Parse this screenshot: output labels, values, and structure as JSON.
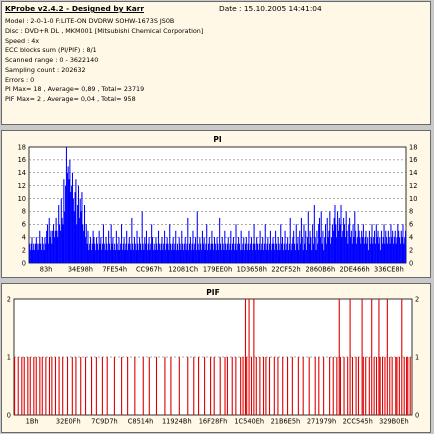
{
  "header": {
    "title": "KProbe v2.4.2 - Designed by Karr",
    "date": "Date : 15.10.2005 14:41:04",
    "lines": [
      "Model : 2-0-1-0 F:LITE-ON DVDRW SOHW-1673S JS0B",
      "Disc : DVD+R DL , MKM001 [Mitsubishi Chemical Corporation]",
      "Speed : 4x",
      "ECC blocks sum (PI/PIF) : 8/1",
      "Scanned range : 0 - 3622140",
      "Sampling count : 202632",
      "Errors : 0",
      "PI Max= 18 , Average= 0,89 , Total= 23719",
      "PIF Max= 2 , Average= 0,04 , Total= 958"
    ]
  },
  "chart_data": [
    {
      "type": "bar",
      "title": "PI",
      "color": "#0000ff",
      "ylim": [
        0,
        18
      ],
      "yticks": [
        "0",
        "2",
        "4",
        "6",
        "8",
        "10",
        "12",
        "14",
        "16",
        "18"
      ],
      "xticks": [
        "83h",
        "34E98h",
        "7FE54h",
        "CC967h",
        "12081Ch",
        "179EE0h",
        "1D3658h",
        "22CF52h",
        "2860B6h",
        "2DE466h",
        "336CE8h"
      ],
      "summary": {
        "max": 18,
        "average": 0.89,
        "total": 23719
      },
      "values": [
        3,
        2,
        3,
        4,
        2,
        3,
        2,
        3,
        4,
        3,
        2,
        3,
        5,
        3,
        2,
        4,
        3,
        2,
        4,
        3,
        5,
        6,
        3,
        7,
        4,
        5,
        3,
        5,
        6,
        4,
        5,
        7,
        5,
        4,
        9,
        6,
        5,
        10,
        7,
        6,
        13,
        8,
        12,
        18,
        14,
        15,
        13,
        16,
        11,
        12,
        14,
        10,
        8,
        11,
        13,
        6,
        9,
        12,
        7,
        10,
        8,
        11,
        6,
        5,
        9,
        4,
        6,
        3,
        5,
        2,
        3,
        4,
        2,
        3,
        5,
        4,
        3,
        2,
        4,
        3,
        2,
        5,
        3,
        4,
        2,
        3,
        6,
        3,
        2,
        4,
        3,
        2,
        5,
        3,
        2,
        6,
        3,
        4,
        2,
        3,
        2,
        5,
        3,
        2,
        4,
        2,
        3,
        6,
        2,
        3,
        4,
        2,
        3,
        5,
        2,
        3,
        4,
        3,
        2,
        7,
        3,
        2,
        4,
        3,
        2,
        5,
        3,
        2,
        4,
        3,
        2,
        8,
        3,
        2,
        4,
        3,
        5,
        2,
        3,
        4,
        2,
        3,
        6,
        4,
        2,
        3,
        2,
        4,
        3,
        2,
        5,
        3,
        2,
        3,
        4,
        2,
        3,
        5,
        2,
        3,
        4,
        3,
        2,
        6,
        3,
        2,
        3,
        4,
        2,
        3,
        5,
        2,
        3,
        2,
        4,
        3,
        2,
        5,
        3,
        2,
        3,
        4,
        2,
        3,
        7,
        2,
        3,
        4,
        2,
        3,
        5,
        2,
        3,
        4,
        2,
        8,
        3,
        2,
        4,
        3,
        2,
        5,
        3,
        4,
        2,
        3,
        6,
        2,
        3,
        4,
        2,
        3,
        5,
        3,
        2,
        4,
        3,
        2,
        4,
        3,
        2,
        7,
        3,
        2,
        4,
        3,
        2,
        5,
        3,
        2,
        3,
        4,
        2,
        3,
        5,
        2,
        3,
        4,
        2,
        3,
        6,
        2,
        3,
        4,
        3,
        2,
        5,
        2,
        3,
        4,
        2,
        3,
        4,
        2,
        3,
        5,
        2,
        3,
        4,
        2,
        3,
        6,
        3,
        2,
        4,
        3,
        2,
        3,
        5,
        2,
        3,
        4,
        2,
        3,
        6,
        2,
        3,
        4,
        2,
        3,
        5,
        2,
        3,
        4,
        3,
        2,
        5,
        3,
        2,
        4,
        3,
        2,
        6,
        3,
        4,
        2,
        3,
        5,
        2,
        3,
        4,
        2,
        3,
        7,
        2,
        3,
        4,
        5,
        3,
        2,
        6,
        3,
        4,
        2,
        5,
        3,
        7,
        4,
        2,
        6,
        3,
        5,
        2,
        4,
        8,
        3,
        5,
        4,
        2,
        6,
        3,
        9,
        4,
        2,
        5,
        3,
        6,
        7,
        4,
        8,
        3,
        5,
        2,
        4,
        6,
        3,
        7,
        4,
        5,
        8,
        3,
        4,
        6,
        5,
        7,
        9,
        6,
        4,
        8,
        5,
        7,
        6,
        9,
        4,
        5,
        7,
        6,
        4,
        8,
        5,
        3,
        6,
        7,
        4,
        5,
        3,
        6,
        4,
        8,
        5,
        3,
        4,
        6,
        5,
        4,
        3,
        5,
        4,
        6,
        3,
        4,
        5,
        3,
        4,
        2,
        5,
        3,
        4,
        6,
        3,
        4,
        5,
        3,
        6,
        4,
        5,
        3,
        4,
        2,
        5,
        3,
        4,
        6,
        3,
        5,
        4,
        3,
        5,
        4,
        3,
        6,
        4,
        5,
        3,
        4,
        5,
        3,
        4,
        6,
        5,
        4,
        3,
        5,
        4,
        6,
        3,
        4,
        5
      ]
    },
    {
      "type": "bar",
      "title": "PIF",
      "color": "#e00000",
      "ylim": [
        0,
        2
      ],
      "yticks": [
        "0",
        "1",
        "2"
      ],
      "xticks": [
        "1Bh",
        "32E0Fh",
        "7C9D7h",
        "C8514h",
        "11924Bh",
        "16F28Fh",
        "1C540Eh",
        "21B6E5h",
        "271979h",
        "2CC545h",
        "329B0Eh"
      ],
      "summary": {
        "max": 2,
        "average": 0.04,
        "total": 958
      },
      "values": [
        1,
        0,
        0,
        1,
        0,
        0,
        1,
        0,
        1,
        0,
        0,
        1,
        0,
        1,
        0,
        0,
        1,
        0,
        1,
        0,
        0,
        1,
        0,
        1,
        0,
        0,
        1,
        0,
        0,
        1,
        0,
        1,
        0,
        0,
        1,
        0,
        0,
        1,
        0,
        0,
        1,
        0,
        0,
        0,
        1,
        0,
        0,
        0,
        1,
        0,
        0,
        1,
        0,
        0,
        0,
        1,
        0,
        0,
        0,
        1,
        0,
        0,
        0,
        0,
        1,
        0,
        0,
        0,
        1,
        0,
        0,
        0,
        0,
        1,
        0,
        0,
        0,
        1,
        0,
        0,
        0,
        0,
        0,
        1,
        0,
        0,
        0,
        0,
        0,
        1,
        0,
        0,
        0,
        0,
        1,
        0,
        0,
        0,
        0,
        0,
        1,
        0,
        0,
        0,
        0,
        0,
        0,
        1,
        0,
        0,
        0,
        0,
        1,
        0,
        0,
        0,
        0,
        0,
        1,
        0,
        0,
        0,
        0,
        0,
        0,
        1,
        0,
        0,
        0,
        0,
        1,
        0,
        0,
        0,
        0,
        0,
        0,
        1,
        0,
        0,
        0,
        0,
        0,
        0,
        1,
        0,
        0,
        0,
        0,
        1,
        0,
        0,
        0,
        1,
        0,
        0,
        0,
        0,
        1,
        0,
        0,
        0,
        0,
        1,
        0,
        0,
        1,
        0,
        0,
        0,
        0,
        1,
        0,
        0,
        0,
        1,
        0,
        1,
        0,
        0,
        0,
        1,
        0,
        0,
        1,
        0,
        0,
        0,
        1,
        0,
        1,
        0,
        2,
        1,
        0,
        2,
        0,
        1,
        0,
        2,
        0,
        1,
        0,
        0,
        1,
        0,
        0,
        1,
        0,
        1,
        0,
        0,
        1,
        0,
        0,
        0,
        1,
        0,
        0,
        1,
        0,
        0,
        0,
        1,
        0,
        0,
        0,
        1,
        0,
        0,
        0,
        1,
        0,
        0,
        0,
        0,
        1,
        0,
        0,
        0,
        1,
        0,
        0,
        0,
        0,
        1,
        0,
        0,
        0,
        0,
        1,
        0,
        0,
        1,
        0,
        0,
        0,
        1,
        0,
        0,
        0,
        0,
        1,
        0,
        0,
        1,
        0,
        0,
        1,
        0,
        2,
        1,
        0,
        0,
        1,
        0,
        0,
        1,
        0,
        2,
        0,
        1,
        0,
        0,
        1,
        0,
        1,
        0,
        0,
        2,
        1,
        0,
        1,
        0,
        0,
        1,
        0,
        2,
        0,
        1,
        0,
        1,
        0,
        2,
        1,
        0,
        1,
        0,
        1,
        0,
        2,
        0,
        1,
        0,
        1,
        0,
        0,
        1,
        1,
        0,
        1,
        0,
        2,
        0,
        1,
        0,
        1,
        1,
        0,
        1,
        0
      ]
    }
  ]
}
